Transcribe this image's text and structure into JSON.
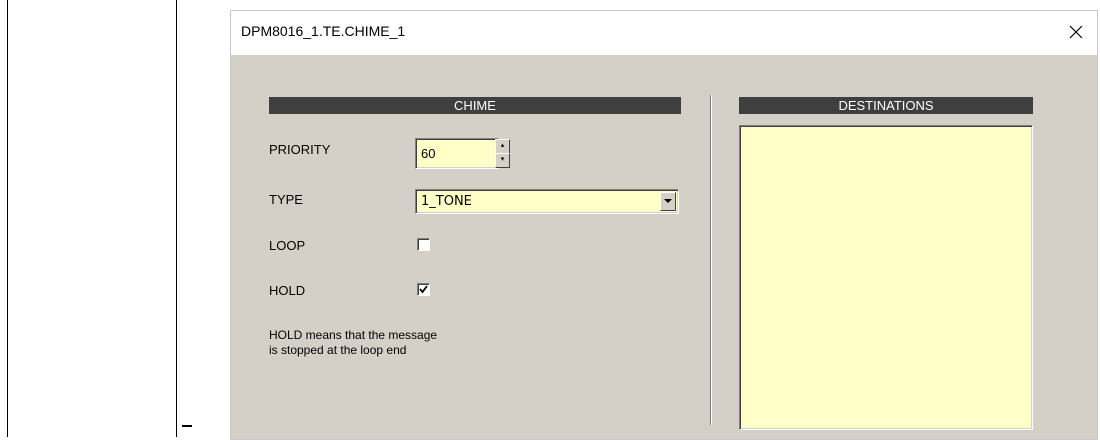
{
  "window": {
    "title": "DPM8016_1.TE.CHIME_1",
    "close_icon": "close-icon"
  },
  "chime": {
    "header": "CHIME",
    "priority_label": "PRIORITY",
    "priority_value": "60",
    "type_label": "TYPE",
    "type_value": "1_TONE",
    "loop_label": "LOOP",
    "loop_checked": false,
    "hold_label": "HOLD",
    "hold_checked": true,
    "note_line1": "HOLD means that the message",
    "note_line2": "is stopped at the loop end"
  },
  "destinations": {
    "header": "DESTINATIONS",
    "items": []
  },
  "colors": {
    "dialog_bg": "#d4d0c8",
    "field_bg": "#ffffc8",
    "header_bg": "#3f3f3f"
  }
}
